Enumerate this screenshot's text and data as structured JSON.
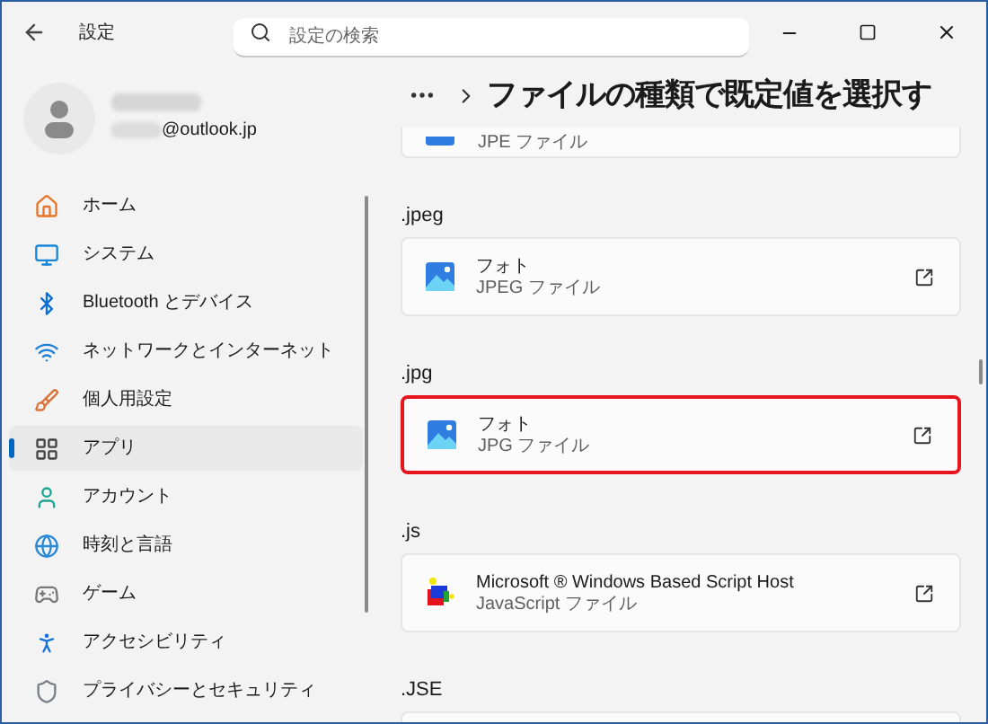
{
  "window": {
    "title": "設定"
  },
  "search": {
    "placeholder": "設定の検索"
  },
  "account": {
    "email": "@outlook.jp"
  },
  "sidebar": {
    "items": [
      {
        "label": "ホーム",
        "selected": false
      },
      {
        "label": "システム",
        "selected": false
      },
      {
        "label": "Bluetooth とデバイス",
        "selected": false
      },
      {
        "label": "ネットワークとインターネット",
        "selected": false
      },
      {
        "label": "個人用設定",
        "selected": false
      },
      {
        "label": "アプリ",
        "selected": true
      },
      {
        "label": "アカウント",
        "selected": false
      },
      {
        "label": "時刻と言語",
        "selected": false
      },
      {
        "label": "ゲーム",
        "selected": false
      },
      {
        "label": "アクセシビリティ",
        "selected": false
      },
      {
        "label": "プライバシーとセキュリティ",
        "selected": false
      }
    ]
  },
  "page": {
    "title": "ファイルの種類で既定値を選択す"
  },
  "sections": [
    {
      "kind": "fragment",
      "subtitle": "JPE ファイル"
    },
    {
      "kind": "full",
      "extension": ".jpeg",
      "app": {
        "kind": "photos",
        "name": "フォト"
      },
      "subtitle": "JPEG ファイル",
      "highlighted": false
    },
    {
      "kind": "full",
      "extension": ".jpg",
      "app": {
        "kind": "photos",
        "name": "フォト"
      },
      "subtitle": "JPG ファイル",
      "highlighted": true
    },
    {
      "kind": "full",
      "extension": ".js",
      "app": {
        "kind": "script",
        "name": "Microsoft ® Windows Based Script Host"
      },
      "subtitle": "JavaScript ファイル",
      "highlighted": false
    },
    {
      "kind": "cut",
      "extension": ".JSE"
    }
  ]
}
